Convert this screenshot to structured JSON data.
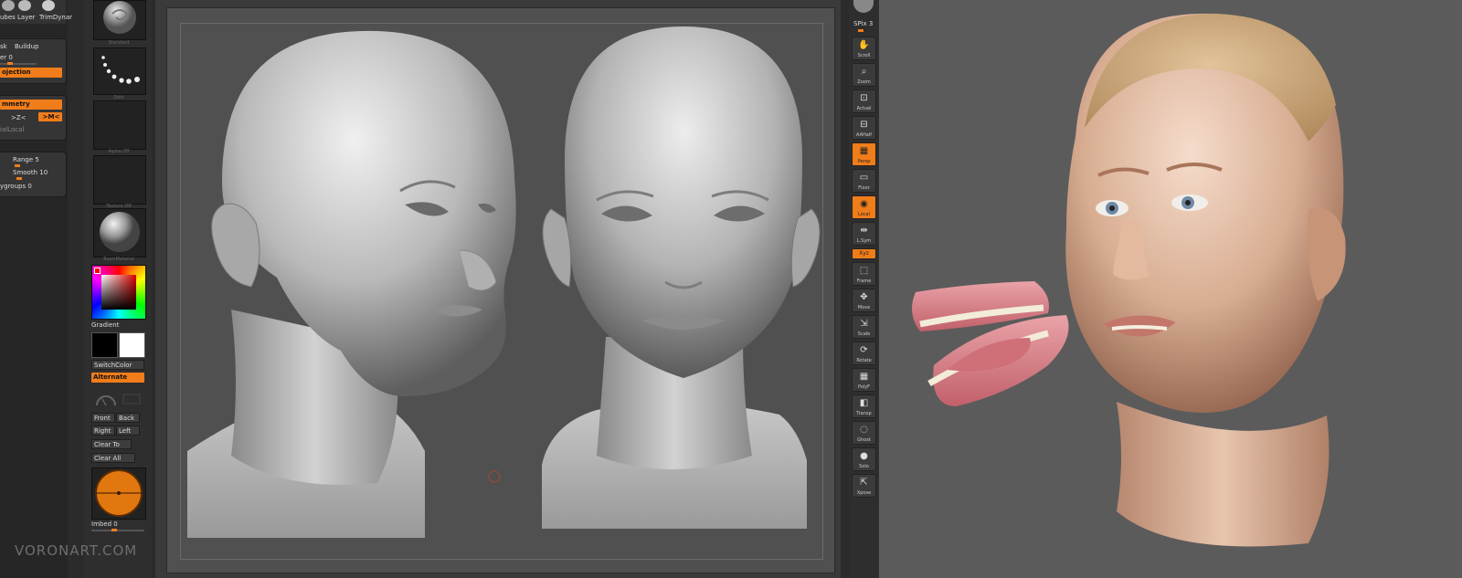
{
  "left_panel": {
    "top_tools": [
      "ubes",
      "Layer",
      "TrimDynar"
    ],
    "brush_modes": {
      "mask": "sk",
      "buildup": "Buildup"
    },
    "layer_row": "er 0",
    "projection": "ojection",
    "symmetry": "mmetry",
    "axis_x": ">Z<",
    "axis_m": ">M<",
    "local_label": "ialLocal",
    "range": "Range 5",
    "smooth": "Smooth 10",
    "polygroups": "ygroups 0"
  },
  "brush_column": {
    "brushes": [
      "Standard",
      "Dots",
      "Alpha Off",
      "Texture Off",
      "BasicMaterial"
    ],
    "gradient": "Gradient",
    "switch_color": "SwitchColor",
    "alternate": "Alternate",
    "view_buttons": [
      "Front",
      "Back",
      "Right",
      "Left",
      "Clear To",
      "Clear All"
    ],
    "imbed": "Imbed 0"
  },
  "right_toolbar": {
    "spix": "SPix 3",
    "buttons": [
      {
        "label": "Scroll",
        "icon": "hand-icon",
        "active": false
      },
      {
        "label": "Zoom",
        "icon": "magnifier-icon",
        "active": false
      },
      {
        "label": "Actual",
        "icon": "actual-size-icon",
        "active": false
      },
      {
        "label": "AAHalf",
        "icon": "half-size-icon",
        "active": false
      },
      {
        "label": "Persp",
        "icon": "perspective-grid-icon",
        "active": true
      },
      {
        "label": "Floor",
        "icon": "floor-icon",
        "active": false
      },
      {
        "label": "Local",
        "icon": "local-pivot-icon",
        "active": true
      },
      {
        "label": "L.Sym",
        "icon": "symmetry-icon",
        "active": false
      },
      {
        "label": "Xyz",
        "icon": "axis-icon",
        "active": true
      },
      {
        "label": "Frame",
        "icon": "frame-icon",
        "active": false
      },
      {
        "label": "Move",
        "icon": "move-hand-icon",
        "active": false
      },
      {
        "label": "Scale",
        "icon": "scale-icon",
        "active": false
      },
      {
        "label": "Rotate",
        "icon": "rotate-icon",
        "active": false
      },
      {
        "label": "PolyF",
        "icon": "polyframe-icon",
        "active": false
      },
      {
        "label": "Transp",
        "icon": "transparency-icon",
        "active": false
      },
      {
        "label": "Ghost",
        "icon": "ghost-icon",
        "active": false
      },
      {
        "label": "Solo",
        "icon": "solo-icon",
        "active": false
      },
      {
        "label": "Xpose",
        "icon": "xpose-icon",
        "active": false
      }
    ]
  },
  "watermark": "VORONART.COM",
  "colors": {
    "accent": "#f07d1a",
    "canvas": "#505050",
    "render_bg": "#5b5b5b"
  }
}
